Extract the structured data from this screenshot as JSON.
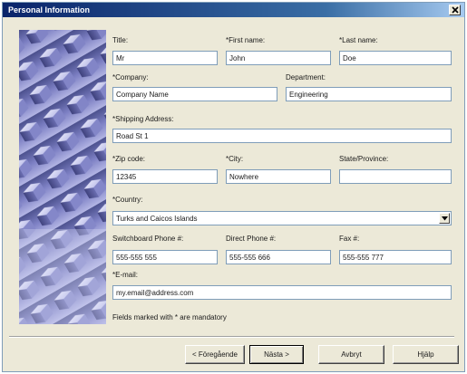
{
  "window": {
    "title": "Personal Information"
  },
  "form": {
    "title_label": "Title:",
    "title_value": "Mr",
    "first_name_label": "*First name:",
    "first_name_value": "John",
    "last_name_label": "*Last name:",
    "last_name_value": "Doe",
    "company_label": "*Company:",
    "company_value": "Company Name",
    "department_label": "Department:",
    "department_value": "Engineering",
    "shipping_label": "*Shipping Address:",
    "shipping_value": "Road St 1",
    "zip_label": "*Zip code:",
    "zip_value": "12345",
    "city_label": "*City:",
    "city_value": "Nowhere",
    "state_label": "State/Province:",
    "state_value": "",
    "country_label": "*Country:",
    "country_value": "Turks and Caicos Islands",
    "switchboard_label": "Switchboard Phone #:",
    "switchboard_value": "555-555 555",
    "direct_label": "Direct Phone #:",
    "direct_value": "555-555 666",
    "fax_label": "Fax #:",
    "fax_value": "555-555 777",
    "email_label": "*E-mail:",
    "email_value": "my.email@address.com",
    "mandatory_note": "Fields marked with * are mandatory"
  },
  "buttons": {
    "back": "< Föregående",
    "next": "Nästa >",
    "cancel": "Avbryt",
    "help": "Hjälp"
  },
  "colors": {
    "title_bar": "#0a246a",
    "dialog_bg": "#ece9d8",
    "field_border": "#7f9db9",
    "image_tint": "#7a7cc0"
  },
  "icons": {
    "close": "close-icon",
    "dropdown": "chevron-down-icon",
    "side_image": "abstract-cubes-image"
  }
}
